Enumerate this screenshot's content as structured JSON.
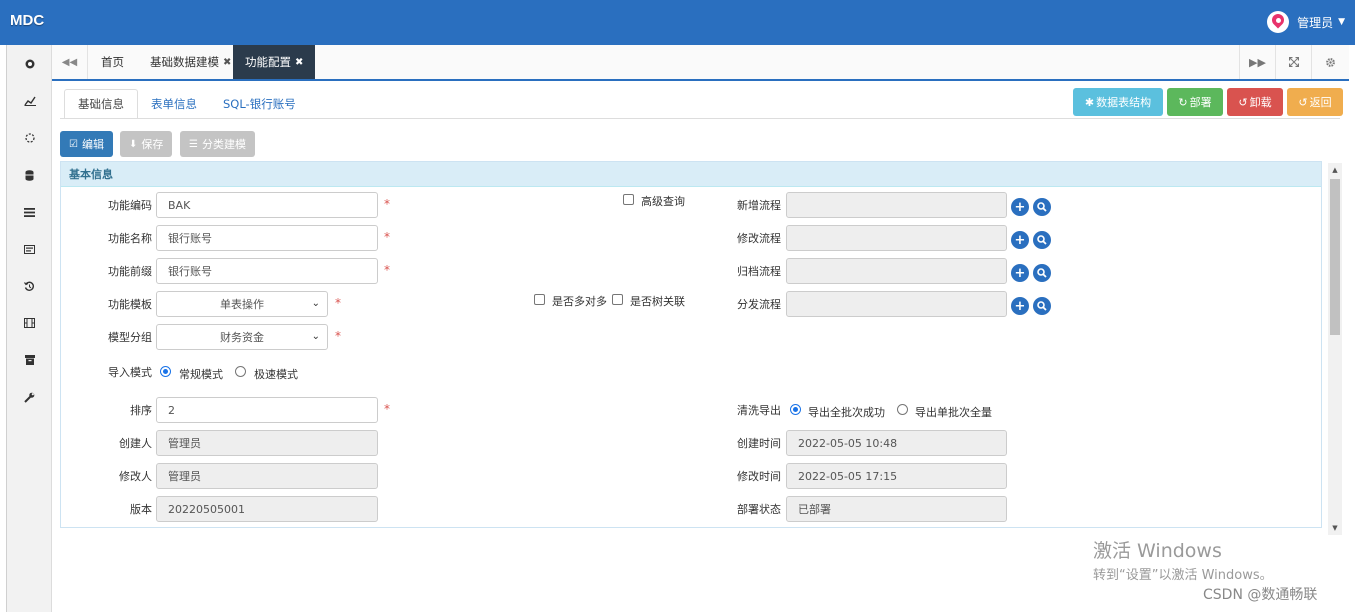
{
  "app": {
    "brand": "MDC",
    "user": "管理员"
  },
  "page_tabs": [
    {
      "label": "首页"
    },
    {
      "label": "基础数据建模"
    },
    {
      "label": "功能配置"
    }
  ],
  "sub_tabs": [
    {
      "label": "基础信息"
    },
    {
      "label": "表单信息"
    },
    {
      "label": "SQL-银行账号"
    }
  ],
  "actions": {
    "structure": "数据表结构",
    "deploy": "部署",
    "undeploy": "卸载",
    "back": "返回"
  },
  "toolbar": {
    "edit": "编辑",
    "save": "保存",
    "classify": "分类建模"
  },
  "panel": {
    "title": "基本信息"
  },
  "form": {
    "func_code": {
      "label": "功能编码",
      "value": "BAK"
    },
    "func_name": {
      "label": "功能名称",
      "value": "银行账号"
    },
    "func_prefix": {
      "label": "功能前缀",
      "value": "银行账号"
    },
    "func_template": {
      "label": "功能模板",
      "value": "单表操作"
    },
    "model_group": {
      "label": "模型分组",
      "value": "财务资金"
    },
    "import_mode": {
      "label": "导入模式",
      "opt1": "常规模式",
      "opt2": "极速模式"
    },
    "sort": {
      "label": "排序",
      "value": "2"
    },
    "creator": {
      "label": "创建人",
      "value": "管理员"
    },
    "modifier": {
      "label": "修改人",
      "value": "管理员"
    },
    "version": {
      "label": "版本",
      "value": "20220505001"
    },
    "advanced_query": "高级查询",
    "multi_to_many": "是否多对多",
    "tree_relation": "是否树关联",
    "new_flow": {
      "label": "新增流程",
      "value": ""
    },
    "edit_flow": {
      "label": "修改流程",
      "value": ""
    },
    "archive_flow": {
      "label": "归档流程",
      "value": ""
    },
    "dispatch_flow": {
      "label": "分发流程",
      "value": ""
    },
    "clean_export": {
      "label": "清洗导出",
      "opt1": "导出全批次成功",
      "opt2": "导出单批次全量"
    },
    "create_time": {
      "label": "创建时间",
      "value": "2022-05-05 10:48"
    },
    "modify_time": {
      "label": "修改时间",
      "value": "2022-05-05 17:15"
    },
    "deploy_status": {
      "label": "部署状态",
      "value": "已部署"
    }
  },
  "overlay": {
    "activate_title": "激活 Windows",
    "activate_sub": "转到“设置”以激活 Windows。",
    "csdn": "CSDN @数通畅联"
  },
  "colors": {
    "primary": "#2a6fbf",
    "info": "#5bc0de",
    "success": "#5cb85c",
    "danger": "#d9534f",
    "warning": "#f0ad4e"
  }
}
